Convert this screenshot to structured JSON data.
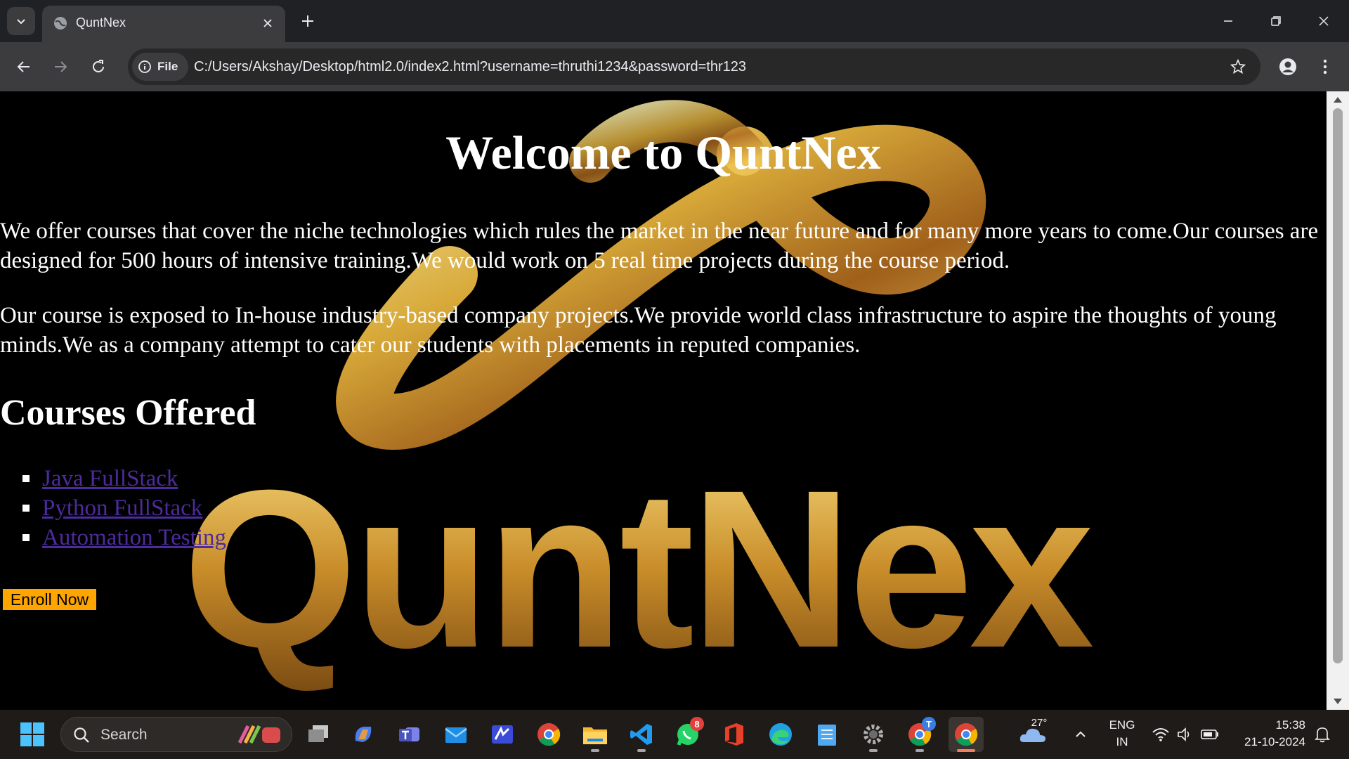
{
  "browser": {
    "tab": {
      "title": "QuntNex"
    },
    "address_bar": {
      "scheme_chip": "File",
      "url": "C:/Users/Akshay/Desktop/html2.0/index2.html?username=thruthi1234&password=thr123"
    }
  },
  "page": {
    "background_logo_text": "QuntNex",
    "title": "Welcome to QuntNex",
    "paragraphs": [
      "We offer courses that cover the niche technologies which rules the market in the near future and for many more years to come.Our courses are designed for 500 hours of intensive training.We would work on 5 real time projects during the course period.",
      "Our course is exposed to In-house industry-based company projects.We provide world class infrastructure to aspire the thoughts of young minds.We as a company attempt to cater our students with placements in reputed companies."
    ],
    "courses_heading": "Courses Offered",
    "courses": [
      "Java FullStack",
      "Python FullStack",
      "Automation Testing"
    ],
    "enroll_button": "Enroll Now"
  },
  "taskbar": {
    "search_label": "Search",
    "weather_temp": "27°",
    "language_line1": "ENG",
    "language_line2": "IN",
    "time": "15:38",
    "date": "21-10-2024",
    "whatsapp_badge": "8",
    "chrome_profile_badge": "T"
  },
  "colors": {
    "link": "#4d2b9c",
    "enroll_button_bg": "#ffa500",
    "page_bg": "#000000",
    "logo_gold": "#d4a017"
  }
}
